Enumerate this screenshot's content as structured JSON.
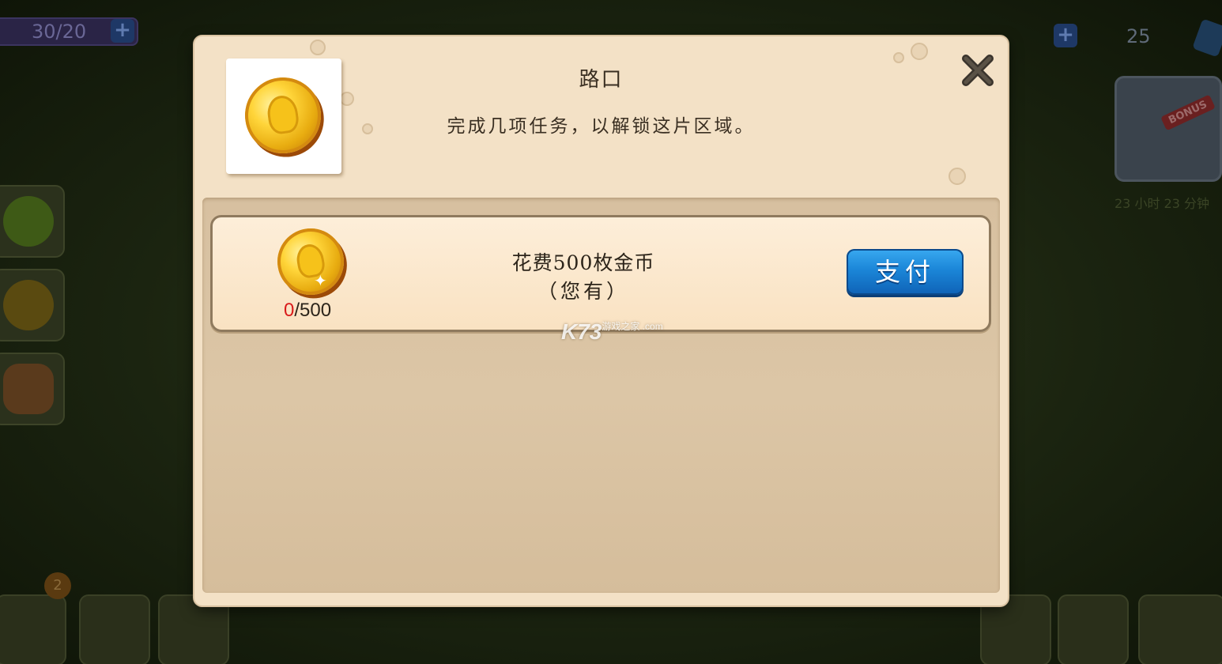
{
  "hud": {
    "energy_value": "30/20",
    "energy_plus": "+",
    "gem_plus": "+",
    "gem_count": "25",
    "bonus_tag": "BONUS",
    "bonus_timer": "23 小时 23 分钟",
    "notify_count": "2"
  },
  "dialog": {
    "title": "路口",
    "description": "完成几项任务，以解锁这片区域。",
    "close_icon": "close-x-icon",
    "cost": {
      "main_text": "花费500枚金币",
      "sub_text": "（您有）",
      "have": "0",
      "separator": "/",
      "required": "500",
      "pay_label": "支付",
      "coin_icon": "gold-coin-icon"
    }
  },
  "watermark": {
    "text": "K73",
    "sub": "游戏之家 .com"
  },
  "colors": {
    "dialog_bg": "#f3e1c6",
    "panel_bg": "#d7c0a0",
    "pay_button": "#1b86d8",
    "have_count": "#d91a1a"
  }
}
